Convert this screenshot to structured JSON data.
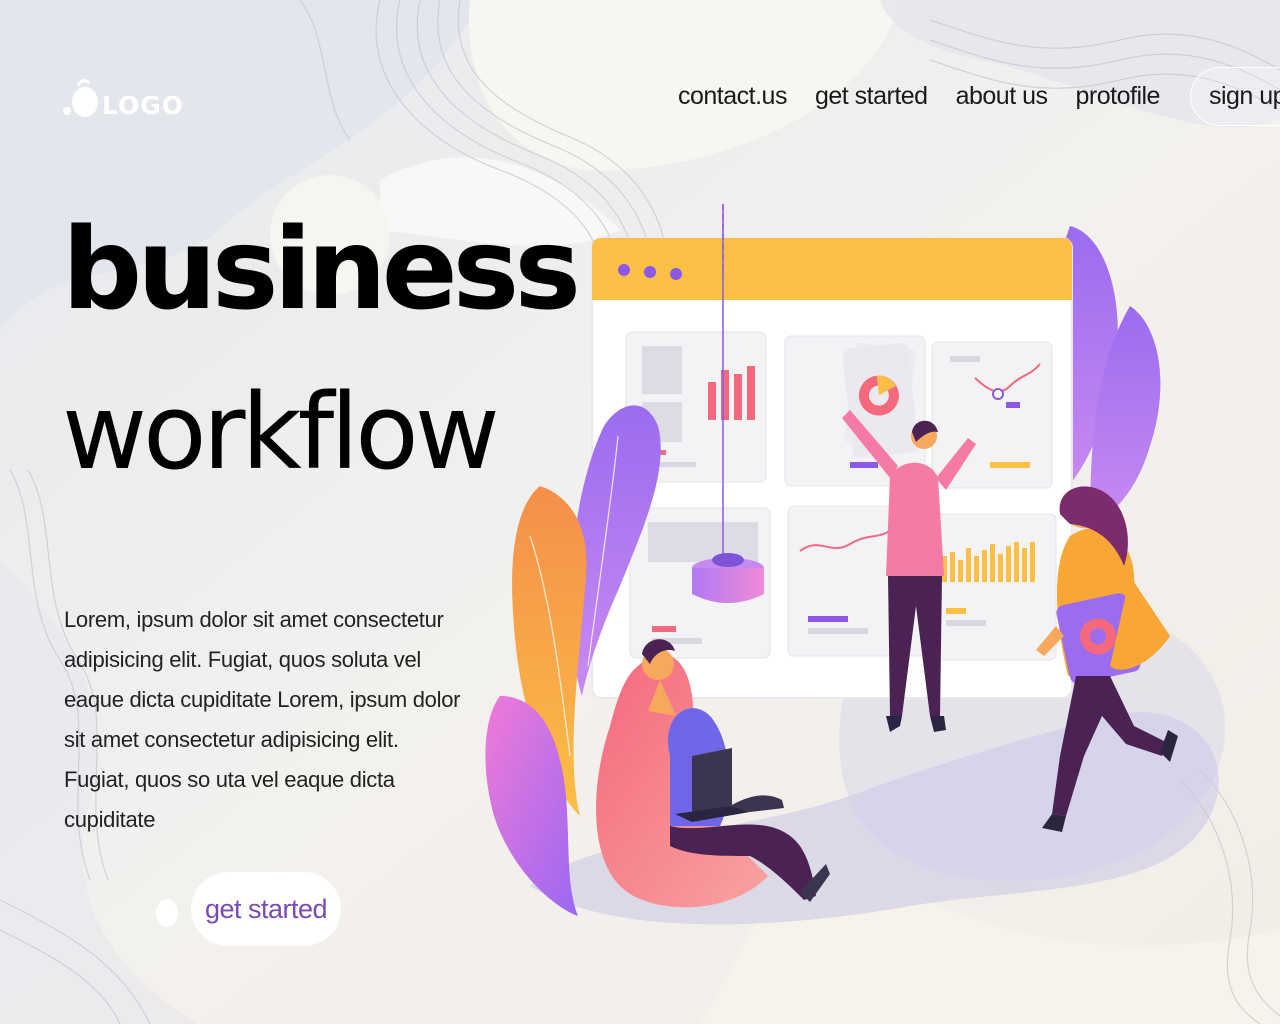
{
  "brand": {
    "logo_text": "LOGO"
  },
  "nav": {
    "links": [
      "contact.us",
      "get started",
      "about us",
      "protofile"
    ],
    "signup_label": "sign up"
  },
  "hero": {
    "title_line1": "business",
    "title_line2": "workflow",
    "body": "Lorem, ipsum dolor sit amet consectetur adipisicing elit. Fugiat, quos soluta vel eaque dicta cupiditate Lorem, ipsum dolor sit amet consectetur adipisicing elit. Fugiat, quos so uta vel eaque dicta cupiditate",
    "cta_label": "get started"
  },
  "colors": {
    "accent_purple": "#7a4bb5",
    "window_bar": "#fbbf46",
    "coral": "#f4697e",
    "orange": "#f79a3c",
    "violet": "#9b6cf0"
  },
  "icons": [
    "logo-mark-icon",
    "window-dot-icon",
    "pie-chart-icon",
    "bar-chart-icon",
    "line-chart-icon",
    "laptop-icon"
  ]
}
